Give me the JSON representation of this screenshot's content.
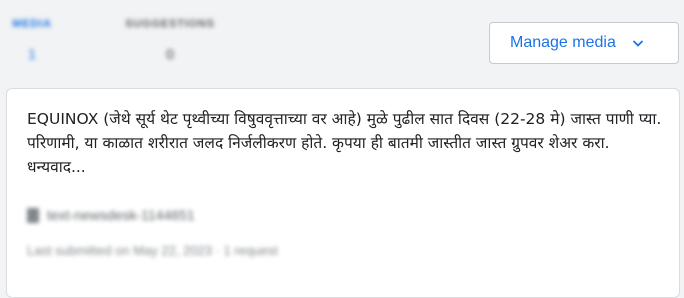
{
  "tabs": [
    {
      "label": "MEDIA",
      "count": "1"
    },
    {
      "label": "SUGGESTIONS",
      "count": "0"
    }
  ],
  "manage_button": {
    "label": "Manage media",
    "icon": "chevron-down-icon"
  },
  "claim": {
    "text": "EQUINOX (जेथे सूर्य थेट पृथ्वीच्या विषुववृत्ताच्या वर आहे) मुळे पुढील सात दिवस (22-28 मे) जास्त पाणी प्या. परिणामी, या काळात शरीरात जलद निर्जलीकरण होते. कृपया ही बातमी जास्तीत जास्त ग्रुपवर शेअर करा. धन्यवाद...",
    "source_name": "text-newsdesk-1144651",
    "source_icon": "document-icon",
    "meta": "Last submitted on May 22, 2023 · 1 request"
  },
  "colors": {
    "accent": "#1a73e8",
    "background": "#f1f3f4",
    "card": "#ffffff"
  }
}
